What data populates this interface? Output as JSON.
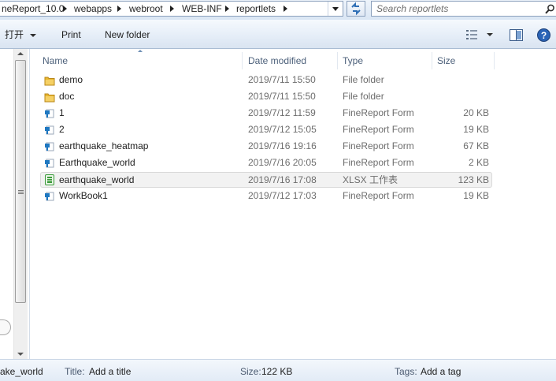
{
  "address_bar": {
    "crumbs": [
      "neReport_10.0",
      "webapps",
      "webroot",
      "WEB-INF",
      "reportlets"
    ]
  },
  "search": {
    "placeholder": "Search reportlets"
  },
  "toolbar": {
    "open_label": "打开",
    "print_label": "Print",
    "new_folder_label": "New folder"
  },
  "columns": {
    "name": "Name",
    "date": "Date modified",
    "type": "Type",
    "size": "Size"
  },
  "files": [
    {
      "name": "demo",
      "date": "2019/7/11 15:50",
      "type": "File folder",
      "size": "",
      "icon": "folder-icon"
    },
    {
      "name": "doc",
      "date": "2019/7/11 15:50",
      "type": "File folder",
      "size": "",
      "icon": "folder-icon"
    },
    {
      "name": "1",
      "date": "2019/7/12 11:59",
      "type": "FineReport Form",
      "size": "20 KB",
      "icon": "finereport-form-icon"
    },
    {
      "name": "2",
      "date": "2019/7/12 15:05",
      "type": "FineReport Form",
      "size": "19 KB",
      "icon": "finereport-form-icon"
    },
    {
      "name": "earthquake_heatmap",
      "date": "2019/7/16 19:16",
      "type": "FineReport Form",
      "size": "67 KB",
      "icon": "finereport-form-icon"
    },
    {
      "name": "Earthquake_world",
      "date": "2019/7/16 20:05",
      "type": "FineReport Form",
      "size": "2 KB",
      "icon": "finereport-form-icon"
    },
    {
      "name": "earthquake_world",
      "date": "2019/7/16 17:08",
      "type": "XLSX 工作表",
      "size": "123 KB",
      "icon": "xlsx-file-icon",
      "selected": true
    },
    {
      "name": "WorkBook1",
      "date": "2019/7/12 17:03",
      "type": "FineReport Form",
      "size": "19 KB",
      "icon": "finereport-form-icon"
    }
  ],
  "details": {
    "filename": "ake_world",
    "title_label": "Title:",
    "title_value": "Add a title",
    "size_label": "Size:",
    "size_value": "122 KB",
    "tags_label": "Tags:",
    "tags_value": "Add a tag"
  },
  "colors": {
    "folder": "#e8b62f",
    "xlsx_green": "#3a9a3a",
    "fr_blue": "#1f78c1"
  }
}
